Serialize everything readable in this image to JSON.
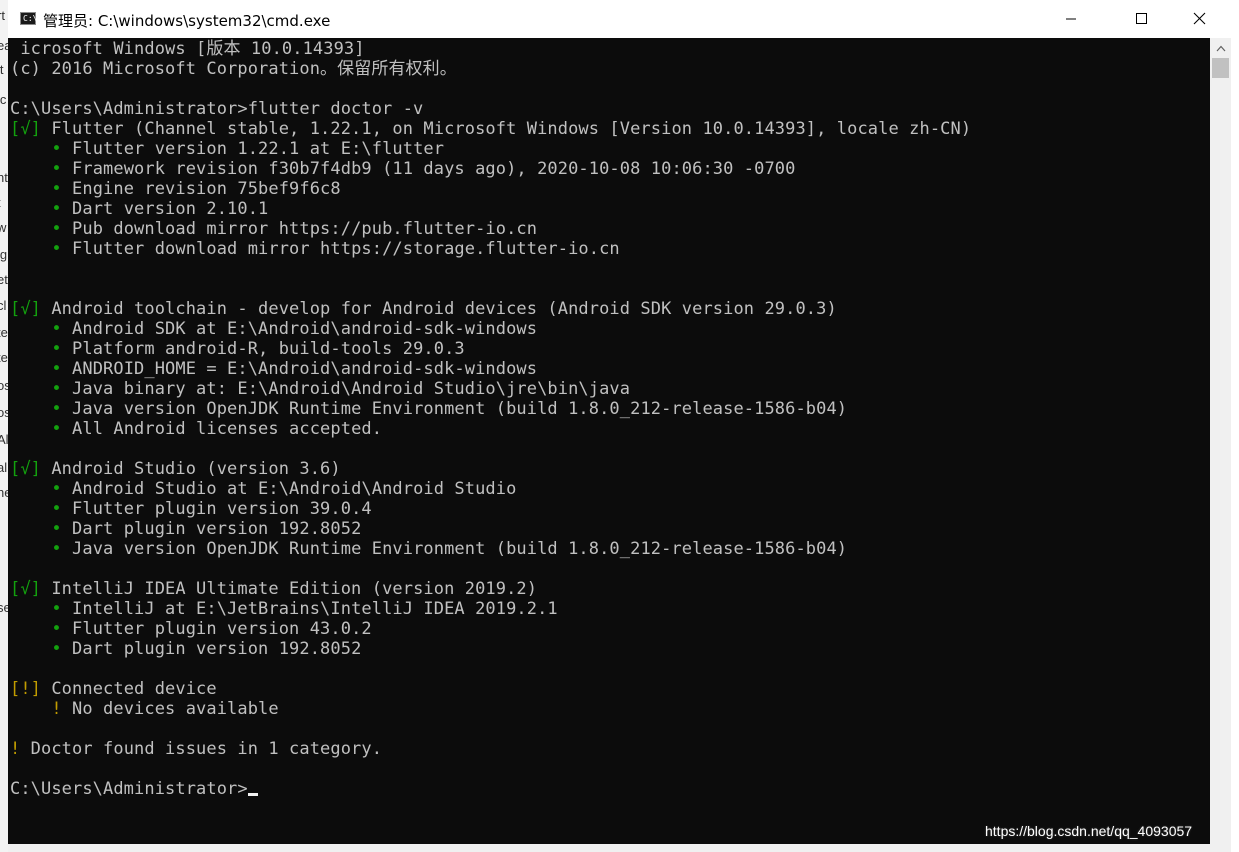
{
  "window": {
    "title": "管理员: C:\\windows\\system32\\cmd.exe",
    "icon_name": "cmd-icon",
    "icon_text": "C:\\",
    "controls": [
      "minimize-icon",
      "maximize-icon",
      "close-icon"
    ]
  },
  "background_fragments": [
    "rt",
    "ea",
    "lt",
    "lc",
    "nt",
    "t",
    "w",
    "ig",
    "et",
    "cl",
    "te",
    "te",
    "os",
    "os",
    "Al",
    "al",
    "ne",
    "se"
  ],
  "console": {
    "lines": [
      [
        {
          "c": "w",
          "t": " icrosoft Windows [版本 10.0.14393]"
        }
      ],
      [
        {
          "c": "w",
          "t": "(c) 2016 Microsoft Corporation。保留所有权利。"
        }
      ],
      [
        {
          "c": "w",
          "t": ""
        }
      ],
      [
        {
          "c": "w",
          "t": "C:\\Users\\Administrator>flutter doctor -v"
        }
      ],
      [
        {
          "c": "g",
          "t": "[√]"
        },
        {
          "c": "w",
          "t": " Flutter (Channel stable, 1.22.1, on Microsoft Windows [Version 10.0.14393], locale zh-CN)"
        }
      ],
      [
        {
          "c": "g",
          "t": "    •"
        },
        {
          "c": "w",
          "t": " Flutter version 1.22.1 at E:\\flutter"
        }
      ],
      [
        {
          "c": "g",
          "t": "    •"
        },
        {
          "c": "w",
          "t": " Framework revision f30b7f4db9 (11 days ago), 2020-10-08 10:06:30 -0700"
        }
      ],
      [
        {
          "c": "g",
          "t": "    •"
        },
        {
          "c": "w",
          "t": " Engine revision 75bef9f6c8"
        }
      ],
      [
        {
          "c": "g",
          "t": "    •"
        },
        {
          "c": "w",
          "t": " Dart version 2.10.1"
        }
      ],
      [
        {
          "c": "g",
          "t": "    •"
        },
        {
          "c": "w",
          "t": " Pub download mirror https://pub.flutter-io.cn"
        }
      ],
      [
        {
          "c": "g",
          "t": "    •"
        },
        {
          "c": "w",
          "t": " Flutter download mirror https://storage.flutter-io.cn"
        }
      ],
      [
        {
          "c": "w",
          "t": ""
        }
      ],
      [
        {
          "c": "w",
          "t": ""
        }
      ],
      [
        {
          "c": "g",
          "t": "[√]"
        },
        {
          "c": "w",
          "t": " Android toolchain - develop for Android devices (Android SDK version 29.0.3)"
        }
      ],
      [
        {
          "c": "g",
          "t": "    •"
        },
        {
          "c": "w",
          "t": " Android SDK at E:\\Android\\android-sdk-windows"
        }
      ],
      [
        {
          "c": "g",
          "t": "    •"
        },
        {
          "c": "w",
          "t": " Platform android-R, build-tools 29.0.3"
        }
      ],
      [
        {
          "c": "g",
          "t": "    •"
        },
        {
          "c": "w",
          "t": " ANDROID_HOME = E:\\Android\\android-sdk-windows"
        }
      ],
      [
        {
          "c": "g",
          "t": "    •"
        },
        {
          "c": "w",
          "t": " Java binary at: E:\\Android\\Android Studio\\jre\\bin\\java"
        }
      ],
      [
        {
          "c": "g",
          "t": "    •"
        },
        {
          "c": "w",
          "t": " Java version OpenJDK Runtime Environment (build 1.8.0_212-release-1586-b04)"
        }
      ],
      [
        {
          "c": "g",
          "t": "    •"
        },
        {
          "c": "w",
          "t": " All Android licenses accepted."
        }
      ],
      [
        {
          "c": "w",
          "t": ""
        }
      ],
      [
        {
          "c": "g",
          "t": "[√]"
        },
        {
          "c": "w",
          "t": " Android Studio (version 3.6)"
        }
      ],
      [
        {
          "c": "g",
          "t": "    •"
        },
        {
          "c": "w",
          "t": " Android Studio at E:\\Android\\Android Studio"
        }
      ],
      [
        {
          "c": "g",
          "t": "    •"
        },
        {
          "c": "w",
          "t": " Flutter plugin version 39.0.4"
        }
      ],
      [
        {
          "c": "g",
          "t": "    •"
        },
        {
          "c": "w",
          "t": " Dart plugin version 192.8052"
        }
      ],
      [
        {
          "c": "g",
          "t": "    •"
        },
        {
          "c": "w",
          "t": " Java version OpenJDK Runtime Environment (build 1.8.0_212-release-1586-b04)"
        }
      ],
      [
        {
          "c": "w",
          "t": ""
        }
      ],
      [
        {
          "c": "g",
          "t": "[√]"
        },
        {
          "c": "w",
          "t": " IntelliJ IDEA Ultimate Edition (version 2019.2)"
        }
      ],
      [
        {
          "c": "g",
          "t": "    •"
        },
        {
          "c": "w",
          "t": " IntelliJ at E:\\JetBrains\\IntelliJ IDEA 2019.2.1"
        }
      ],
      [
        {
          "c": "g",
          "t": "    •"
        },
        {
          "c": "w",
          "t": " Flutter plugin version 43.0.2"
        }
      ],
      [
        {
          "c": "g",
          "t": "    •"
        },
        {
          "c": "w",
          "t": " Dart plugin version 192.8052"
        }
      ],
      [
        {
          "c": "w",
          "t": ""
        }
      ],
      [
        {
          "c": "y",
          "t": "[!]"
        },
        {
          "c": "w",
          "t": " Connected device"
        }
      ],
      [
        {
          "c": "y",
          "t": "    !"
        },
        {
          "c": "w",
          "t": " No devices available"
        }
      ],
      [
        {
          "c": "w",
          "t": ""
        }
      ],
      [
        {
          "c": "y",
          "t": "!"
        },
        {
          "c": "w",
          "t": " Doctor found issues in 1 category."
        }
      ],
      [
        {
          "c": "w",
          "t": ""
        }
      ],
      [
        {
          "c": "w",
          "t": "C:\\Users\\Administrator>"
        }
      ]
    ],
    "colors": {
      "text": "#c0c0c0",
      "green": "#13a10e",
      "yellow": "#c19c00",
      "background": "#0c0c0c"
    }
  },
  "watermark": "https://blog.csdn.net/qq_4093057"
}
